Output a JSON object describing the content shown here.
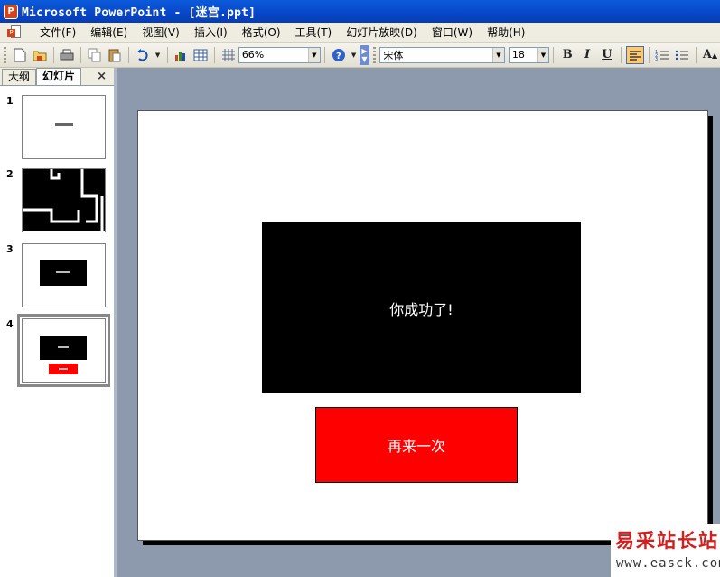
{
  "window": {
    "title": "Microsoft PowerPoint - [迷宫.ppt]",
    "app_icon_letter": "P"
  },
  "menubar": {
    "items": [
      "文件(F)",
      "编辑(E)",
      "视图(V)",
      "插入(I)",
      "格式(O)",
      "工具(T)",
      "幻灯片放映(D)",
      "窗口(W)",
      "帮助(H)"
    ]
  },
  "toolbar": {
    "zoom": "66%",
    "font_name": "宋体",
    "font_size": "18",
    "bold": "B",
    "italic": "I",
    "underline": "U",
    "font_grow": "A"
  },
  "left_pane": {
    "tabs": [
      "大纲",
      "幻灯片"
    ],
    "active_tab": "幻灯片",
    "close": "×",
    "slides": [
      {
        "number": "1"
      },
      {
        "number": "2"
      },
      {
        "number": "3"
      },
      {
        "number": "4"
      }
    ],
    "selected_slide": "4"
  },
  "slide": {
    "message": "你成功了!",
    "retry_button": "再来一次"
  },
  "watermark": {
    "name": "易采站长站",
    "url": "www.easck.com"
  },
  "colors": {
    "titlebar": "#0846C8",
    "workspace": "#8D9AAD",
    "retry": "#FF0000"
  }
}
